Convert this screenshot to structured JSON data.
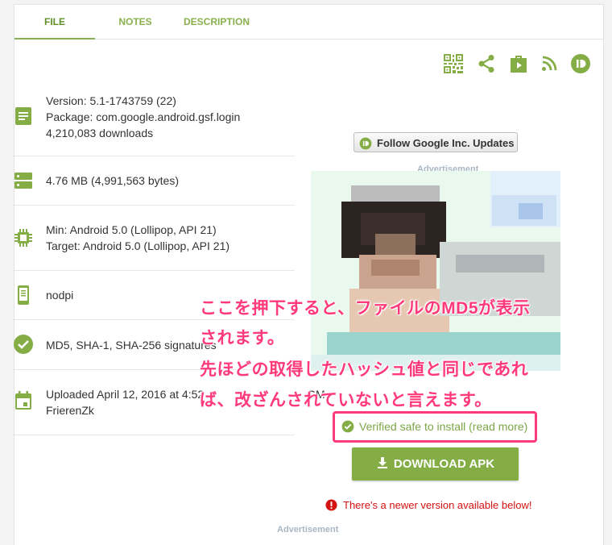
{
  "tabs": [
    {
      "label": "FILE",
      "active": true
    },
    {
      "label": "NOTES",
      "active": false
    },
    {
      "label": "DESCRIPTION",
      "active": false
    }
  ],
  "toolbar_icons": [
    "qr-code-icon",
    "share-icon",
    "play-store-icon",
    "rss-icon",
    "pushbullet-icon"
  ],
  "info": {
    "version": "Version: 5.1-1743759 (22)",
    "package": "Package: com.google.android.gsf.login",
    "downloads": "4,210,083 downloads",
    "size": "4.76 MB (4,991,563 bytes)",
    "min": "Min: Android 5.0 (Lollipop, API 21)",
    "target": "Target: Android 5.0 (Lollipop, API 21)",
    "dpi": "nodpi",
    "signatures": "MD5, SHA-1, SHA-256 signatures",
    "uploaded": "Uploaded April 12, 2016 at 4:52",
    "uploaded_tail": "GM",
    "uploader": "FrierenZk"
  },
  "follow_button": "Follow Google Inc. Updates",
  "ad_label": "Advertisement",
  "annotation": {
    "line1": "ここを押下すると、ファイルのMD5が表示",
    "line2": "されます。",
    "line3": "先ほどの取得したハッシュ値と同じであれ",
    "line4": "ば、改ざんされていないと言えます。"
  },
  "verified": "Verified safe to install (read more)",
  "download_button": "DOWNLOAD APK",
  "newer_notice": "There's a newer version available below!",
  "colors": {
    "accent_green": "#84ad46",
    "annotation_pink": "#ff3a7a",
    "warning_red": "#d41212"
  }
}
